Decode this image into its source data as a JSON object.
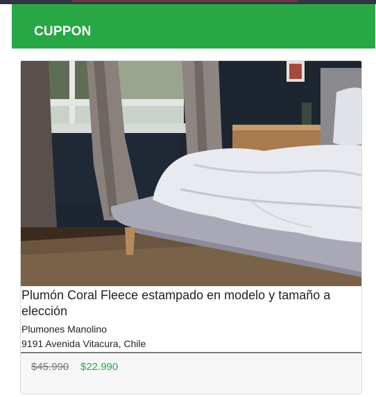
{
  "header": {
    "brand": "CUPPON",
    "accent_color": "#28a745"
  },
  "deal": {
    "image": "bedroom-bed-photo",
    "title": "Plumón Coral Fleece estampado en modelo y tamaño a elección",
    "merchant": "Plumones Manolino",
    "address": "9191 Avenida Vitacura, Chile",
    "original_price": "$45.990",
    "discount_price": "$22.990"
  }
}
